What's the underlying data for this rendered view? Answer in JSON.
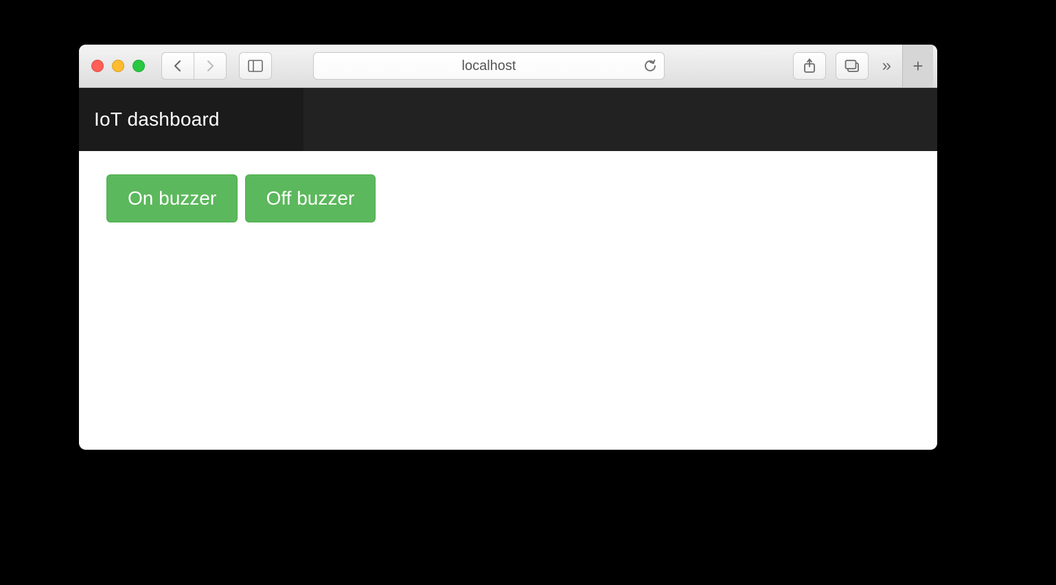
{
  "browser": {
    "address": "localhost"
  },
  "navbar": {
    "brand": "IoT dashboard"
  },
  "main": {
    "buttons": {
      "on_buzzer_label": "On buzzer",
      "off_buzzer_label": "Off buzzer"
    }
  }
}
